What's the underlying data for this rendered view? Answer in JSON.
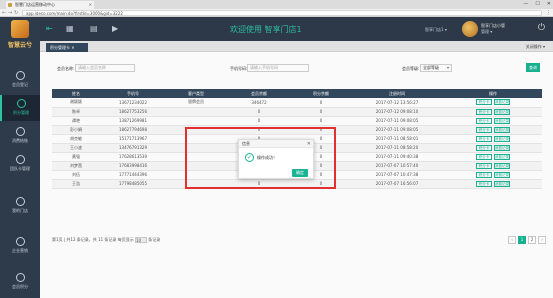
{
  "browser": {
    "tab_title": "智慧门店运营移动中心",
    "url": "app.ideco.com/main.do?firstId=3000&gid=3222",
    "win_min": "—",
    "win_max": "☐",
    "win_close": "✕"
  },
  "sidebar": {
    "logo_text": "智慧云兮",
    "items": [
      {
        "label": "会员登记",
        "active": false
      },
      {
        "label": "积分管理",
        "active": true
      },
      {
        "label": "消费结账",
        "active": false
      },
      {
        "label": "团队卡管理",
        "active": false
      },
      {
        "label": "我的门店",
        "active": false
      },
      {
        "label": "企业营销",
        "active": false
      },
      {
        "label": "会员积分",
        "active": false
      }
    ]
  },
  "header": {
    "welcome": "欢迎使用 智享门店1",
    "store_selector": "智享门店1 ▾",
    "user_name": "智享门店小管",
    "user_role": "管理 ▾"
  },
  "subtabs": {
    "active_tab": "积分管理卡 ✕",
    "close_ops": "关闭操作 ▾"
  },
  "search": {
    "label1": "会员名称:",
    "placeholder1": "请输入会员名称",
    "label2": "手机号码:",
    "placeholder2": "请输入手机号码",
    "label3": "会员等级:",
    "select_value": "全部等级",
    "button": "查询"
  },
  "table": {
    "headers": [
      "姓名",
      "手机号",
      "客户类型",
      "会员余额",
      "积分余额",
      "注册时间",
      "操作"
    ],
    "row_buttons": [
      "积分卡",
      "消费记录"
    ],
    "rows": [
      [
        "谢颖颖",
        "13671234022",
        "银牌会员",
        "346472",
        "0",
        "2017-07-12 13:56:27"
      ],
      [
        "陈卓",
        "18627753256",
        "",
        "0",
        "0",
        "2017-07-12 09:08:10"
      ],
      [
        "谭艳",
        "13871269981",
        "",
        "0",
        "0",
        "2017-07-11 09:08:05"
      ],
      [
        "彭小娟",
        "18627794698",
        "",
        "0",
        "0",
        "2017-07-11 09:08:05"
      ],
      [
        "胡克敏",
        "15171713967",
        "",
        "0",
        "0",
        "2017-07-11 08:58:01"
      ],
      [
        "王小波",
        "13476791329",
        "",
        "0",
        "0",
        "2017-07-11 08:58:20"
      ],
      [
        "黄强",
        "17628613539",
        "",
        "0",
        "0",
        "2017-07-11 09:40:38"
      ],
      [
        "刘梦茜",
        "17683998416",
        "",
        "0",
        "0",
        "2017-07-07 10:57:40"
      ],
      [
        "刘伍",
        "17771444396",
        "",
        "0",
        "0",
        "2017-07-07 10:47:38"
      ],
      [
        "王浩",
        "17798485055",
        "",
        "0",
        "0",
        "2017-07-07 16:56:07"
      ]
    ]
  },
  "footer": {
    "info_prefix": "第1页 | 共12 条记录，共 11 条记录 每页显示",
    "info_suffix": "条记录",
    "page_size": "10",
    "pages": [
      "‹",
      "1",
      "2",
      "›"
    ]
  },
  "dialog": {
    "title": "信息",
    "close": "✕",
    "icon": "✓",
    "message": "操作成功！",
    "ok": "确定"
  }
}
